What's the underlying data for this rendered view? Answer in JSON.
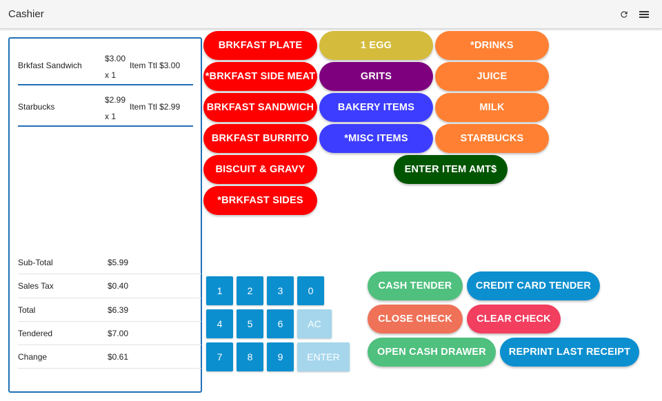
{
  "appbar": {
    "title": "Cashier",
    "refresh_icon": "refresh-icon",
    "menu_icon": "hamburger-menu-icon"
  },
  "order": {
    "items": [
      {
        "name": "Brkfast Sandwich",
        "price": "$3.00",
        "qty": "x 1",
        "total": "Item Ttl $3.00"
      },
      {
        "name": "Starbucks",
        "price": "$2.99",
        "qty": "x 1",
        "total": "Item Ttl $2.99"
      }
    ],
    "totals": [
      {
        "label": "Sub-Total",
        "value": "$5.99"
      },
      {
        "label": "Sales Tax",
        "value": "$0.40"
      },
      {
        "label": "Total",
        "value": "$6.39"
      },
      {
        "label": "Tendered",
        "value": "$7.00"
      },
      {
        "label": "Change",
        "value": "$0.61"
      }
    ]
  },
  "menu_buttons": {
    "brkfast_plate": "BRKFAST PLATE",
    "brkfast_side_meat": "*BRKFAST SIDE MEAT",
    "brkfast_sandwich": "BRKFAST SANDWICH",
    "brkfast_burrito": "BRKFAST BURRITO",
    "biscuit_gravy": "BISCUIT & GRAVY",
    "brkfast_sides": "*BRKFAST SIDES",
    "one_egg": "1 EGG",
    "grits": "GRITS",
    "bakery_items": "BAKERY ITEMS",
    "misc_items": "*MISC ITEMS",
    "drinks": "*DRINKS",
    "juice": "JUICE",
    "milk": "MILK",
    "starbucks": "STARBUCKS",
    "enter_item_amt": "ENTER ITEM AMT$"
  },
  "keypad": {
    "k1": "1",
    "k2": "2",
    "k3": "3",
    "k0": "0",
    "k4": "4",
    "k5": "5",
    "k6": "6",
    "ac": "AC",
    "k7": "7",
    "k8": "8",
    "k9": "9",
    "enter": "ENTER"
  },
  "actions": {
    "cash_tender": "CASH TENDER",
    "credit_card_tender": "CREDIT CARD TENDER",
    "close_check": "CLOSE CHECK",
    "clear_check": "CLEAR CHECK",
    "open_cash_drawer": "OPEN CASH DRAWER",
    "reprint_last_receipt": "REPRINT LAST RECEIPT"
  },
  "colors": {
    "red": "#ff0000",
    "gold": "#d4bb3c",
    "purple": "#7e007e",
    "blue": "#3d3dff",
    "orange": "#ff8033",
    "dark_green": "#005500",
    "keypad_blue": "#0c8fcf",
    "keypad_disabled": "#a5d6ec",
    "green": "#4fc07e",
    "salmon": "#ef7258",
    "pink": "#f23e5f",
    "panel_border": "#1e6fb4"
  }
}
